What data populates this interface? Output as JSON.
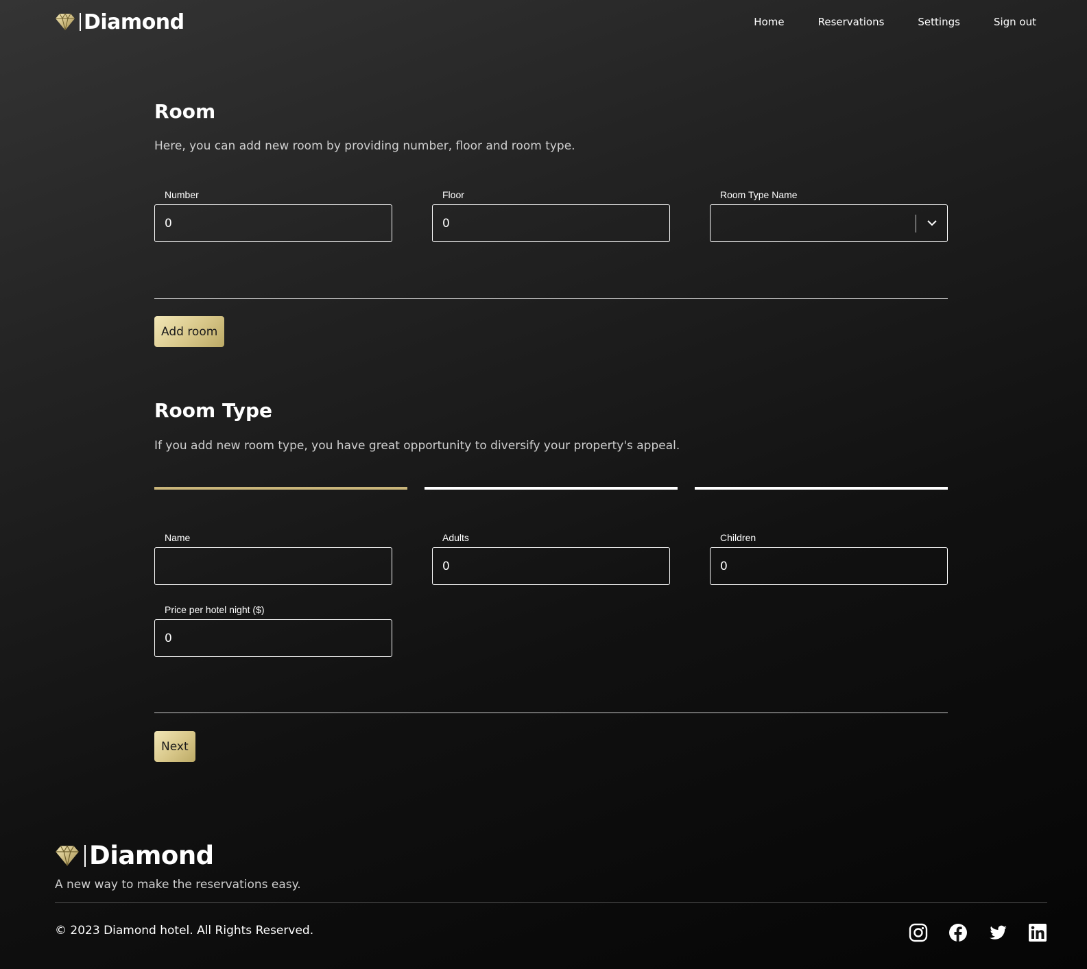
{
  "brand": {
    "name": "Diamond",
    "logo_icon": "diamond-icon"
  },
  "nav": {
    "home": "Home",
    "reservations": "Reservations",
    "settings": "Settings",
    "signout": "Sign out"
  },
  "room": {
    "title": "Room",
    "description": "Here, you can add new room by providing number, floor and room type.",
    "number_label": "Number",
    "number_value": "0",
    "floor_label": "Floor",
    "floor_value": "0",
    "type_label": "Room Type Name",
    "type_value": "",
    "add_button": "Add room"
  },
  "room_type": {
    "title": "Room Type",
    "description": "If you add new room type, you have great opportunity to diversify your property's appeal.",
    "steps": [
      {
        "state": "active",
        "color": "#c9b57a"
      },
      {
        "state": "inactive",
        "color": "#ffffff"
      },
      {
        "state": "inactive",
        "color": "#ffffff"
      }
    ],
    "name_label": "Name",
    "name_value": "",
    "adults_label": "Adults",
    "adults_value": "0",
    "children_label": "Children",
    "children_value": "0",
    "price_label": "Price per hotel night ($)",
    "price_value": "0",
    "next_button": "Next"
  },
  "footer": {
    "brand": "Diamond",
    "tagline": "A new way to make the reservations easy.",
    "copyright": "© 2023 Diamond hotel. All Rights Reserved.",
    "social_icons": [
      "instagram-icon",
      "facebook-icon",
      "twitter-icon",
      "linkedin-icon"
    ]
  },
  "colors": {
    "accent_gold": "#c9b57a",
    "button_gold_light": "#f1e6b6",
    "background_dark": "#1a1a1a"
  }
}
